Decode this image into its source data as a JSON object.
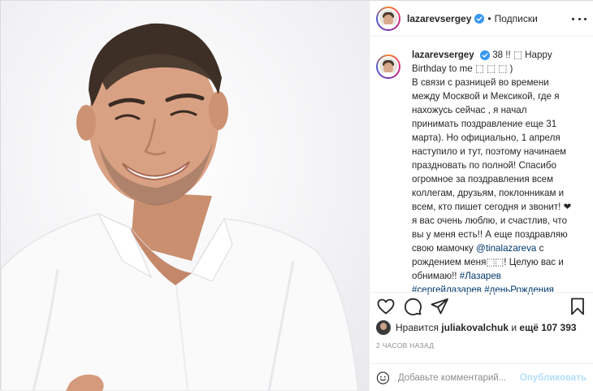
{
  "photo": {
    "description_icon": "portrait-photo"
  },
  "header": {
    "username": "lazarevsergey",
    "separator": "•",
    "follow_status": "Подписки",
    "more_icon": "more-horizontal-icon"
  },
  "caption": {
    "username": "lazarevsergey",
    "lines": [
      "38 !! ⬚ Happy",
      "Birthday to me ⬚ ⬚ ⬚ )",
      "В связи с разницей во времени",
      "между Москвой и Мексикой, где я",
      "нахожусь сейчас , я начал",
      "принимать поздравление еще 31",
      "марта). Но официально, 1 апреля",
      "наступило и тут, поэтому начинаем",
      "праздновать по полной! Спасибо",
      "огромное за поздравления всем",
      "коллегам, друзьям, поклонникам и",
      "всем, кто пишет сегодня и звонит! ❤",
      "я вас очень люблю, и счастлив, что",
      "вы у меня есть!! А еще поздравляю",
      "свою мамочку ",
      " с",
      "рождением меня⬚⬚! Целую вас и",
      "обнимаю!! ",
      "#Лазарев",
      "#сергейлазарев",
      "#деньРождения"
    ],
    "mention": "@tinalazareva"
  },
  "actions": {
    "like_icon": "heart-icon",
    "comment_icon": "comment-icon",
    "share_icon": "share-icon",
    "save_icon": "bookmark-icon"
  },
  "likes": {
    "prefix": "Нравится",
    "user": "juliakovalchuk",
    "middle": "и",
    "more": "ещё 107 393"
  },
  "timestamp": "2 ЧАСОВ НАЗАД",
  "comment": {
    "placeholder": "Добавьте комментарий...",
    "publish_label": "Опубликовать",
    "emoji_icon": "smiley-icon"
  },
  "colors": {
    "verified": "#3897f0",
    "link": "#00376b",
    "muted": "#8e8e8e",
    "publish_disabled": "#b2dffc"
  }
}
